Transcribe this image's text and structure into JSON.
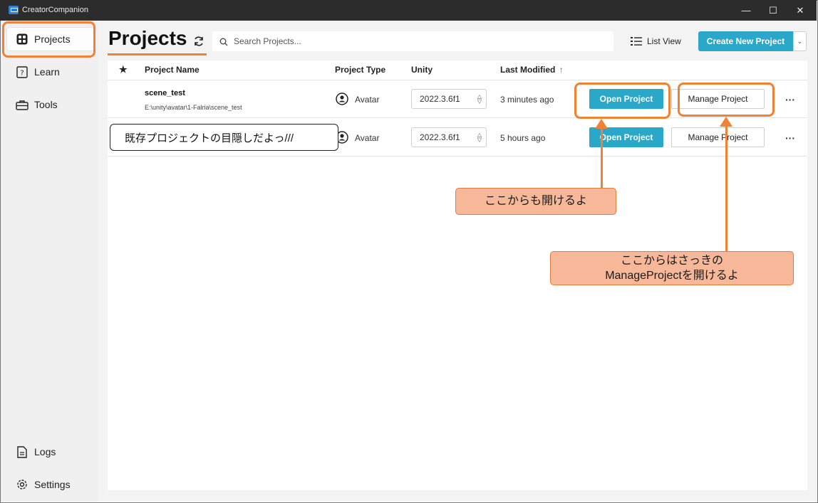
{
  "window": {
    "title": "CreatorCompanion",
    "controls": [
      "—",
      "☐",
      "✕"
    ]
  },
  "sidebar": {
    "items": [
      {
        "label": "Projects",
        "icon": "projects-grid-icon"
      },
      {
        "label": "Learn",
        "icon": "help-book-icon"
      },
      {
        "label": "Tools",
        "icon": "toolbox-icon"
      }
    ],
    "bottom_items": [
      {
        "label": "Logs",
        "icon": "document-icon"
      },
      {
        "label": "Settings",
        "icon": "gear-icon"
      }
    ]
  },
  "header": {
    "title": "Projects",
    "search_placeholder": "Search Projects...",
    "list_view_label": "List View",
    "create_label": "Create New Project"
  },
  "table": {
    "columns": {
      "star": "★",
      "name": "Project Name",
      "type": "Project Type",
      "unity": "Unity",
      "modified": "Last Modified",
      "sort_arrow": "↑"
    },
    "rows": [
      {
        "name": "scene_test",
        "path": "E:\\unity\\avatar\\1-Falria\\scene_test",
        "type": "Avatar",
        "unity": "2022.3.6f1",
        "modified": "3 minutes ago",
        "open_label": "Open Project",
        "manage_label": "Manage Project",
        "more": "···"
      },
      {
        "name": "",
        "path": "",
        "type": "Avatar",
        "unity": "2022.3.6f1",
        "modified": "5 hours ago",
        "open_label": "Open Project",
        "manage_label": "Manage Project",
        "more": "···"
      }
    ]
  },
  "annotations": {
    "mask_note": "既存プロジェクトの目隠しだよっ///",
    "callout_open": "ここからも開けるよ",
    "callout_manage_line1": "ここからはさっきの",
    "callout_manage_line2": "ManageProjectを開けるよ",
    "highlight_color": "#ef8235"
  },
  "colors": {
    "accent": "#2aa7c9",
    "titlebar": "#2c2c2c",
    "callout_fill": "#f7b89a"
  }
}
